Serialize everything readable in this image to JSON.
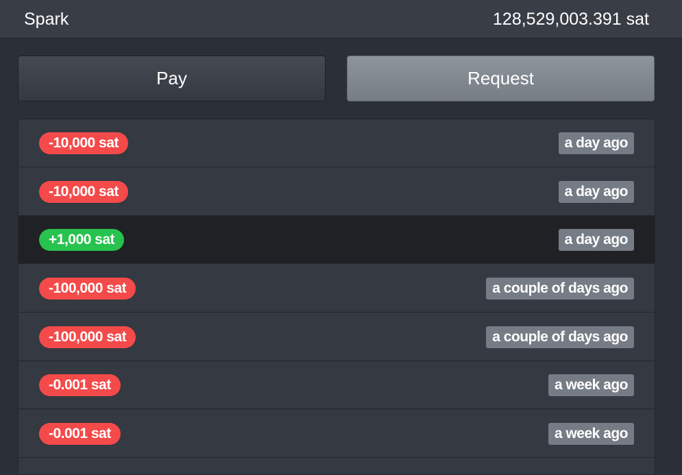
{
  "header": {
    "title": "Spark",
    "balance": "128,529,003.391 sat"
  },
  "actions": {
    "pay_label": "Pay",
    "request_label": "Request"
  },
  "colors": {
    "negative": "#f44a4a",
    "positive": "#28c24e",
    "time_badge": "#757c85"
  },
  "payments": [
    {
      "amount": "-10,000 sat",
      "direction": "out",
      "time": "a day ago"
    },
    {
      "amount": "-10,000 sat",
      "direction": "out",
      "time": "a day ago"
    },
    {
      "amount": "+1,000 sat",
      "direction": "in",
      "time": "a day ago",
      "selected": true
    },
    {
      "amount": "-100,000 sat",
      "direction": "out",
      "time": "a couple of days ago"
    },
    {
      "amount": "-100,000 sat",
      "direction": "out",
      "time": "a couple of days ago"
    },
    {
      "amount": "-0.001 sat",
      "direction": "out",
      "time": "a week ago"
    },
    {
      "amount": "-0.001 sat",
      "direction": "out",
      "time": "a week ago"
    }
  ]
}
